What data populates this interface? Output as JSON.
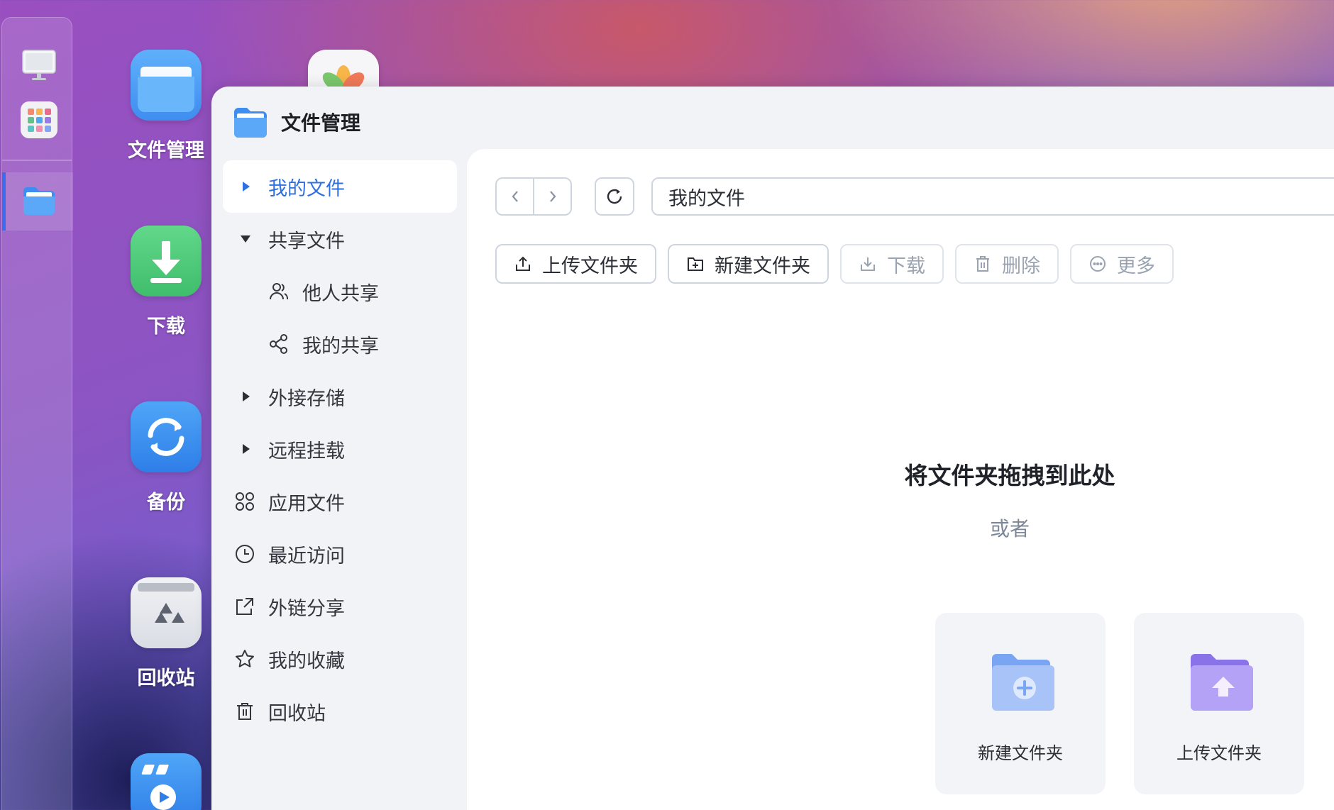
{
  "dock": {
    "items": [
      {
        "name": "desktop",
        "icon": "monitor-icon"
      },
      {
        "name": "app-center",
        "icon": "app-grid-icon"
      },
      {
        "name": "file-manager",
        "icon": "folder-icon",
        "active": true
      }
    ]
  },
  "desktop": {
    "icons": [
      {
        "label": "文件管理",
        "icon": "folder-icon"
      },
      {
        "label": "下载",
        "icon": "download-icon"
      },
      {
        "label": "备份",
        "icon": "backup-sync-icon"
      },
      {
        "label": "回收站",
        "icon": "recycle-bin-icon"
      },
      {
        "label": "",
        "icon": "video-player-icon"
      },
      {
        "label": "",
        "icon": "photos-icon"
      }
    ]
  },
  "window": {
    "title": "文件管理",
    "sidebar": [
      {
        "label": "我的文件",
        "icon": "caret-right-icon",
        "active": true
      },
      {
        "label": "共享文件",
        "icon": "caret-down-icon"
      },
      {
        "label": "他人共享",
        "icon": "users-icon",
        "sub": true
      },
      {
        "label": "我的共享",
        "icon": "share-icon",
        "sub": true
      },
      {
        "label": "外接存储",
        "icon": "caret-right-icon"
      },
      {
        "label": "远程挂载",
        "icon": "caret-right-icon"
      },
      {
        "label": "应用文件",
        "icon": "apps-icon"
      },
      {
        "label": "最近访问",
        "icon": "clock-icon"
      },
      {
        "label": "外链分享",
        "icon": "external-share-icon"
      },
      {
        "label": "我的收藏",
        "icon": "star-icon"
      },
      {
        "label": "回收站",
        "icon": "trash-icon"
      }
    ],
    "path": "我的文件",
    "toolbar": [
      {
        "label": "上传文件夹",
        "icon": "upload-icon",
        "enabled": true
      },
      {
        "label": "新建文件夹",
        "icon": "new-folder-icon",
        "enabled": true
      },
      {
        "label": "下载",
        "icon": "download-icon",
        "enabled": false
      },
      {
        "label": "删除",
        "icon": "trash-icon",
        "enabled": false
      },
      {
        "label": "更多",
        "icon": "more-icon",
        "enabled": false
      }
    ],
    "empty_state": {
      "title": "将文件夹拖拽到此处",
      "or": "或者",
      "cards": [
        {
          "label": "新建文件夹",
          "icon": "folder-plus-icon"
        },
        {
          "label": "上传文件夹",
          "icon": "folder-upload-icon"
        }
      ]
    }
  },
  "colors": {
    "accent": "#2f6fe0",
    "window_bg": "#f1f3f7",
    "content_bg": "#ffffff",
    "border": "#cfd5df",
    "disabled_text": "#9aa3b1"
  }
}
